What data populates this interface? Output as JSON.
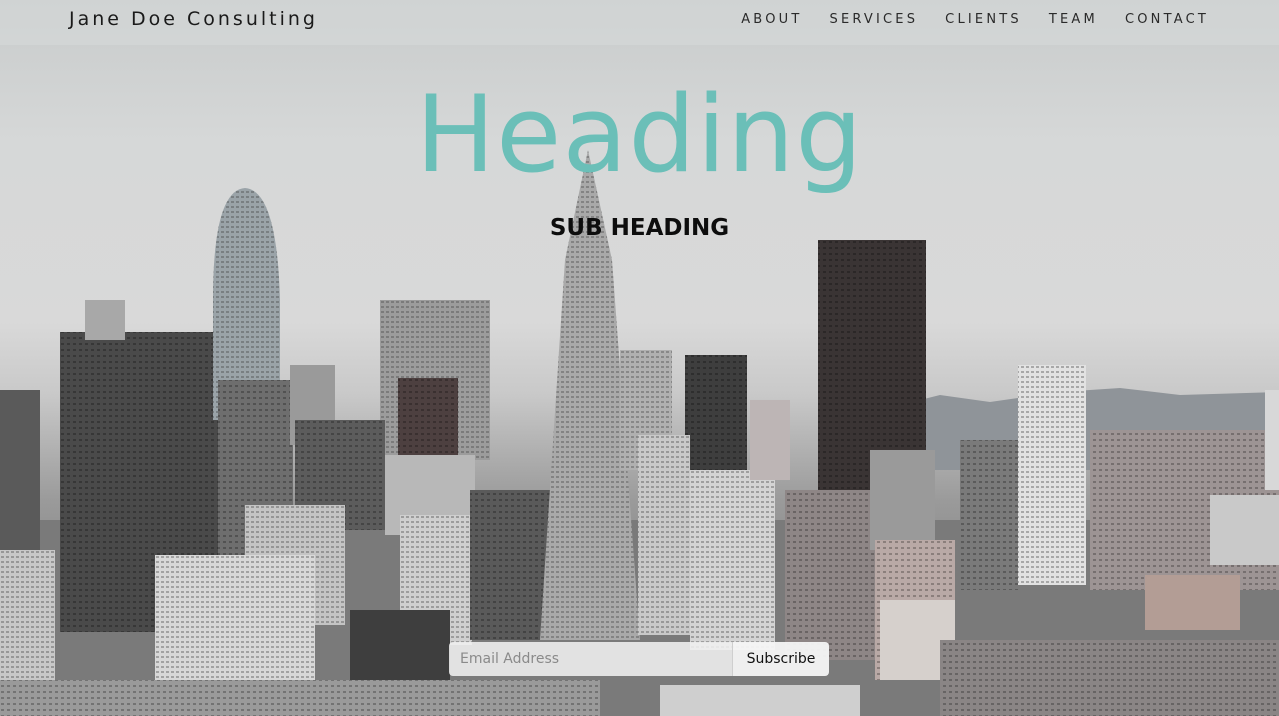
{
  "brand": {
    "name": "Jane Doe Consulting"
  },
  "nav": {
    "items": [
      {
        "label": "ABOUT"
      },
      {
        "label": "SERVICES"
      },
      {
        "label": "CLIENTS"
      },
      {
        "label": "TEAM"
      },
      {
        "label": "CONTACT"
      }
    ]
  },
  "hero": {
    "heading": "Heading",
    "subheading": "SUB HEADING",
    "background": "city-skyline-photo"
  },
  "subscribe": {
    "email_placeholder": "Email Address",
    "button_label": "Subscribe"
  },
  "colors": {
    "heading_accent": "#6bbfb8",
    "text_dark": "#111111"
  }
}
